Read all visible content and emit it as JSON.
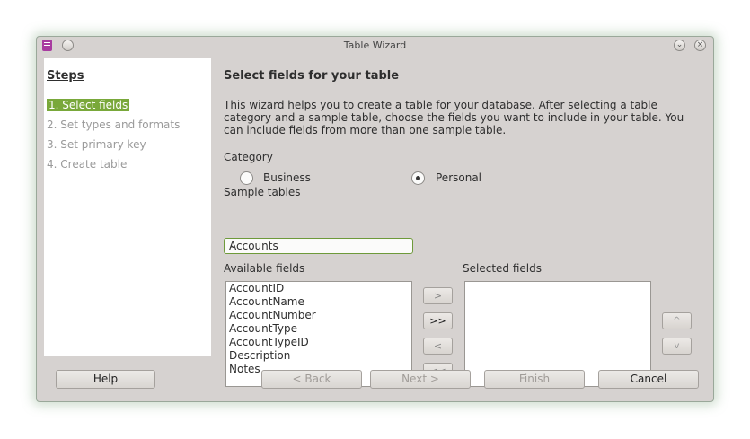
{
  "window": {
    "title": "Table Wizard"
  },
  "steps": {
    "title": "Steps",
    "items": [
      {
        "label": "1. Select fields",
        "active": true
      },
      {
        "label": "2. Set types and formats",
        "active": false
      },
      {
        "label": "3. Set primary key",
        "active": false
      },
      {
        "label": "4. Create table",
        "active": false
      }
    ]
  },
  "main": {
    "heading": "Select fields for your table",
    "intro": "This wizard helps you to create a table for your database. After selecting a table category and a sample table, choose the fields you want to include in your table. You can include fields from more than one sample table.",
    "category_label": "Category",
    "category_options": [
      {
        "label": "Business",
        "selected": false
      },
      {
        "label": "Personal",
        "selected": true
      }
    ],
    "sample_tables_label": "Sample tables",
    "sample_tables_value": "Accounts",
    "available_fields_label": "Available fields",
    "available_fields": [
      "AccountID",
      "AccountName",
      "AccountNumber",
      "AccountType",
      "AccountTypeID",
      "Description",
      "Notes"
    ],
    "selected_fields_label": "Selected fields",
    "selected_fields": [],
    "move_buttons": [
      ">",
      ">>",
      "<",
      "<<"
    ],
    "order_buttons": [
      "^",
      "v"
    ]
  },
  "footer": {
    "help": "Help",
    "back": "< Back",
    "next": "Next >",
    "finish": "Finish",
    "cancel": "Cancel"
  },
  "colors": {
    "accent": "#79a83a",
    "window_bg": "#d6d2d0"
  }
}
